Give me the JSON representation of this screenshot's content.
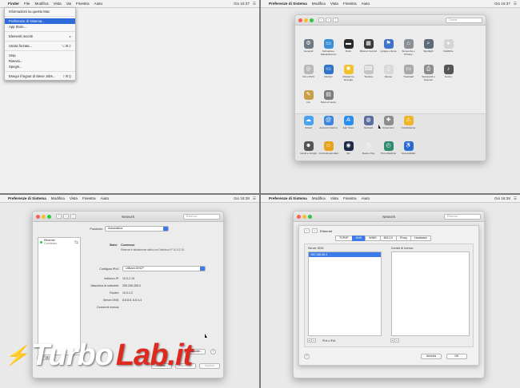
{
  "q1": {
    "menubar": {
      "app": "Finder",
      "items": [
        "File",
        "Modifica",
        "Vista",
        "Vai",
        "Finestra",
        "Aiuto"
      ],
      "clock": "Gio 16:37"
    },
    "apple_menu": [
      {
        "label": "Informazioni su questo Mac",
        "shortcut": ""
      },
      {
        "sep": true
      },
      {
        "label": "Preferenze di Sistema...",
        "shortcut": "",
        "selected": true
      },
      {
        "label": "App Store...",
        "shortcut": ""
      },
      {
        "sep": true
      },
      {
        "label": "Elementi recenti",
        "shortcut": "▸"
      },
      {
        "sep": true
      },
      {
        "label": "Uscita forzata...",
        "shortcut": "⌥⌘⎋"
      },
      {
        "sep": true
      },
      {
        "label": "Stop",
        "shortcut": ""
      },
      {
        "label": "Riavvia...",
        "shortcut": ""
      },
      {
        "label": "Spegni...",
        "shortcut": ""
      },
      {
        "sep": true
      },
      {
        "label": "Esegui il logout di Steve Jobs...",
        "shortcut": "⇧⌘Q"
      }
    ]
  },
  "q2": {
    "menubar": {
      "app": "Preferenze di Sistema",
      "items": [
        "Modifica",
        "Vista",
        "Finestra",
        "Aiuto"
      ],
      "clock": "Gio 16:37"
    },
    "search_placeholder": "Cerca",
    "rows": [
      [
        {
          "label": "Generali",
          "icon": "gear-icon",
          "color": "#6e7a86"
        },
        {
          "label": "Scrivania e Salvaschermo",
          "icon": "desktop-icon",
          "color": "#3b8fd4"
        },
        {
          "label": "Dock",
          "icon": "dock-icon",
          "color": "#2b2b2b"
        },
        {
          "label": "Mission Control",
          "icon": "mission-control-icon",
          "color": "#3a3a3a"
        },
        {
          "label": "Lingua e Zona",
          "icon": "flag-icon",
          "color": "#3f73c9"
        },
        {
          "label": "Sicurezza e Privacy",
          "icon": "house-lock-icon",
          "color": "#8a8f96"
        },
        {
          "label": "Spotlight",
          "icon": "magnifier-icon",
          "color": "#5e6b77"
        },
        {
          "label": "Notifiche",
          "icon": "notification-icon",
          "color": "#d4d4d4"
        }
      ],
      [
        {
          "label": "CD e DVD",
          "icon": "disc-icon",
          "color": "#b8b8b8"
        },
        {
          "label": "Monitor",
          "icon": "monitor-icon",
          "color": "#2f74c8"
        },
        {
          "label": "Risparmio Energia",
          "icon": "bulb-icon",
          "color": "#f2c12e"
        },
        {
          "label": "Tastiera",
          "icon": "keyboard-icon",
          "color": "#c5c5c5"
        },
        {
          "label": "Mouse",
          "icon": "mouse-icon",
          "color": "#d9d9d9"
        },
        {
          "label": "Trackpad",
          "icon": "trackpad-icon",
          "color": "#a9a9a9"
        },
        {
          "label": "Stampanti e Scanner",
          "icon": "printer-icon",
          "color": "#8c8c8c"
        },
        {
          "label": "Suono",
          "icon": "speaker-icon",
          "color": "#555"
        }
      ],
      [
        {
          "label": "Ink",
          "icon": "pen-icon",
          "color": "#c9a04a"
        },
        {
          "label": "Disco di avvio",
          "icon": "drive-icon",
          "color": "#7d7d7d"
        }
      ],
      [
        {
          "label": "iCloud",
          "icon": "cloud-icon",
          "color": "#4aa3ee"
        },
        {
          "label": "Account Internet",
          "icon": "at-icon",
          "color": "#3b86e0"
        },
        {
          "label": "App Store",
          "icon": "appstore-icon",
          "color": "#2a8ff0"
        },
        {
          "label": "Network",
          "icon": "globe-icon",
          "color": "#5a6fa0"
        },
        {
          "label": "Estensioni",
          "icon": "puzzle-icon",
          "color": "#8c8c8c"
        },
        {
          "label": "Condivisione",
          "icon": "share-icon",
          "color": "#f0b429"
        }
      ],
      [
        {
          "label": "Utenti e Gruppi",
          "icon": "users-icon",
          "color": "#555"
        },
        {
          "label": "Controlli parentali",
          "icon": "parental-icon",
          "color": "#e8a21d"
        },
        {
          "label": "Siri",
          "icon": "siri-icon",
          "color": "#1f2a4a"
        },
        {
          "label": "Data e Ora",
          "icon": "clock-icon",
          "color": "#e5e5e5"
        },
        {
          "label": "Time Machine",
          "icon": "timemachine-icon",
          "color": "#2f8b6f"
        },
        {
          "label": "Accessibilità",
          "icon": "accessibility-icon",
          "color": "#2a6fd6"
        }
      ]
    ]
  },
  "q3": {
    "menubar": {
      "app": "Preferenze di Sistema",
      "items": [
        "Modifica",
        "Vista",
        "Finestra",
        "Aiuto"
      ],
      "clock": "Gio 16:38"
    },
    "title": "Network",
    "search_placeholder": "Ricerca",
    "location_label": "Posizione:",
    "location_value": "Automatica",
    "service_name": "Ethernet",
    "service_status": "Connesso",
    "status_label": "Stato:",
    "status_value": "Connesso",
    "status_desc": "Ethernet è attualmente attivo con l'indirizzo IP 10.0.2.15.",
    "fields": [
      {
        "label": "Configura IPv4:",
        "value": "Utilizza DHCP",
        "select": true
      },
      {
        "label": "Indirizzo IP:",
        "value": "10.0.2.15"
      },
      {
        "label": "Maschera di sottorete:",
        "value": "255.255.255.0"
      },
      {
        "label": "Router:",
        "value": "10.0.2.2"
      },
      {
        "label": "Server DNS:",
        "value": "8.8.8.8, 8.8.4.4"
      },
      {
        "label": "Domini di ricerca:",
        "value": ""
      }
    ],
    "advanced_btn": "Avanzate...",
    "help_btn": "?",
    "assist_btn": "Aiutami...",
    "revert_btn": "Ripristina",
    "apply_btn": "Applica"
  },
  "q4": {
    "menubar": {
      "app": "Preferenze di Sistema",
      "items": [
        "Modifica",
        "Vista",
        "Finestra",
        "Aiuto"
      ],
      "clock": "Gio 16:38"
    },
    "title": "Network",
    "search_placeholder": "Ricerca",
    "sheet_title": "Ethernet",
    "tabs": [
      "TCP/IP",
      "DNS",
      "WINS",
      "802.1X",
      "Proxy",
      "Hardware"
    ],
    "active_tab": 1,
    "dns_label": "Server DNS:",
    "dns_entry": "192.168.56.3",
    "domains_label": "Domini di ricerca:",
    "ipv_label": "IPv4 o IPv6",
    "cancel_btn": "Annulla",
    "ok_btn": "OK"
  },
  "watermark": {
    "part1": "Turbo",
    "part2": "Lab.it"
  }
}
